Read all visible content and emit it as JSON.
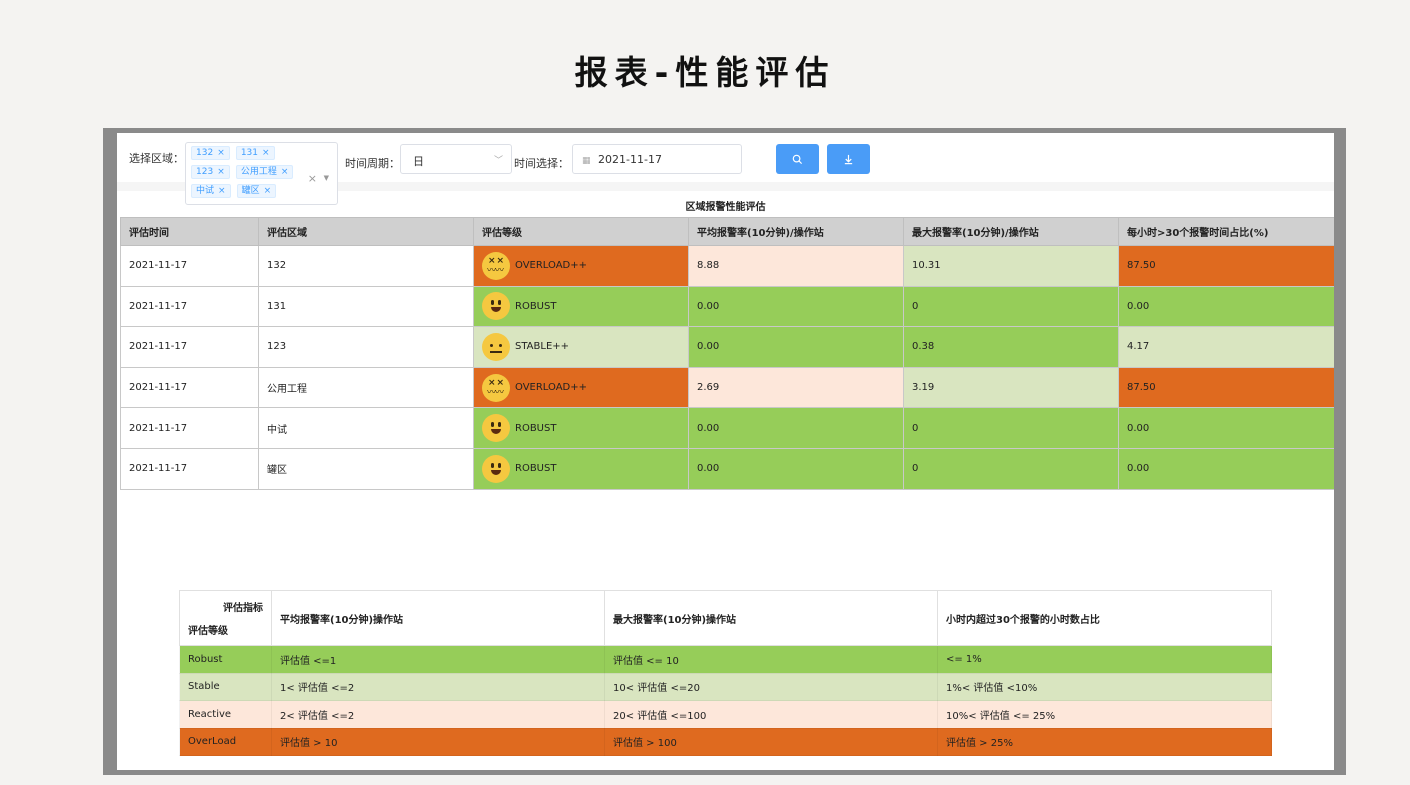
{
  "page_heading": "报表-性能评估",
  "filters": {
    "region_label": "选择区域：",
    "region_tags": [
      "132",
      "131",
      "123",
      "公用工程",
      "中试",
      "罐区"
    ],
    "period_label": "时间周期：",
    "period_value": "日",
    "date_label": "时间选择：",
    "date_value": "2021-11-17"
  },
  "buttons": {
    "search_icon": "search-icon",
    "export_icon": "download-icon"
  },
  "main_table": {
    "title": "区域报警性能评估",
    "headers": [
      "评估时间",
      "评估区域",
      "评估等级",
      "平均报警率(10分钟)/操作站",
      "最大报警率(10分钟)/操作站",
      "每小时>30个报警时间占比(%)"
    ],
    "rows": [
      {
        "date": "2021-11-17",
        "area": "132",
        "level": "OVERLOAD++",
        "face": "dizzy",
        "avg": "8.88",
        "max": "10.31",
        "pct": "87.50"
      },
      {
        "date": "2021-11-17",
        "area": "131",
        "level": "ROBUST",
        "face": "happy",
        "avg": "0.00",
        "max": "0",
        "pct": "0.00"
      },
      {
        "date": "2021-11-17",
        "area": "123",
        "level": "STABLE++",
        "face": "neutral",
        "avg": "0.00",
        "max": "0.38",
        "pct": "4.17"
      },
      {
        "date": "2021-11-17",
        "area": "公用工程",
        "level": "OVERLOAD++",
        "face": "dizzy",
        "avg": "2.69",
        "max": "3.19",
        "pct": "87.50"
      },
      {
        "date": "2021-11-17",
        "area": "中试",
        "level": "ROBUST",
        "face": "happy",
        "avg": "0.00",
        "max": "0",
        "pct": "0.00"
      },
      {
        "date": "2021-11-17",
        "area": "罐区",
        "level": "ROBUST",
        "face": "happy",
        "avg": "0.00",
        "max": "0",
        "pct": "0.00"
      }
    ]
  },
  "legend_table": {
    "corner_top": "评估指标",
    "corner_bottom": "评估等级",
    "headers": [
      "平均报警率(10分钟)操作站",
      "最大报警率(10分钟)操作站",
      "小时内超过30个报警的小时数占比"
    ],
    "rows": [
      {
        "grade": "Robust",
        "c1": "评估值 <=1",
        "c2": "评估值 <= 10",
        "c3": "<= 1%"
      },
      {
        "grade": "Stable",
        "c1": "1< 评估值 <=2",
        "c2": "10< 评估值 <=20",
        "c3": "1%< 评估值 <10%"
      },
      {
        "grade": "Reactive",
        "c1": "2< 评估值 <=2",
        "c2": "20< 评估值 <=100",
        "c3": "10%< 评估值 <= 25%"
      },
      {
        "grade": "OverLoad",
        "c1": "评估值 > 10",
        "c2": "评估值 > 100",
        "c3": "评估值 > 25%"
      }
    ]
  },
  "colors": {
    "robust_green": "#96cd59",
    "stable_pale": "#d9e5c0",
    "reactive_peach": "#fde7da",
    "overload_orange": "#df6a1f",
    "button_blue": "#4a9cf7"
  }
}
